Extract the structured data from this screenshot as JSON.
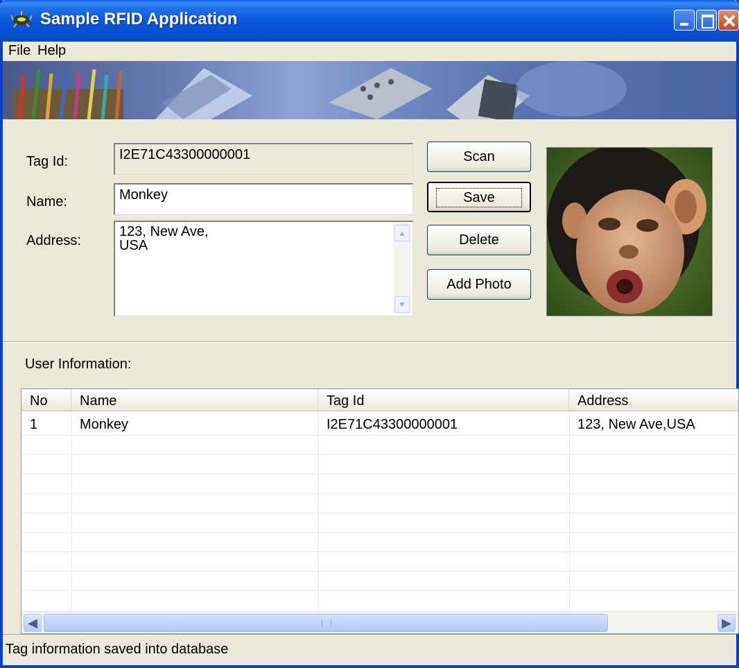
{
  "window": {
    "title": "Sample RFID Application",
    "titlebar_color": "#0a56d8"
  },
  "menu": {
    "items": [
      {
        "label": "File",
        "mnemonic": "F"
      },
      {
        "label": "Help",
        "mnemonic": "H"
      }
    ]
  },
  "form": {
    "tag_id_label": "Tag Id:",
    "tag_id_value": "I2E71C43300000001",
    "name_label": "Name:",
    "name_value": "Monkey",
    "address_label": "Address:",
    "address_line1": "123, New Ave,",
    "address_line2": "USA"
  },
  "buttons": {
    "scan": "Scan",
    "save": "Save",
    "delete": "Delete",
    "add_photo": "Add Photo"
  },
  "user_info": {
    "heading": "User Information:",
    "columns": [
      "No",
      "Name",
      "Tag Id",
      "Address"
    ],
    "rows": [
      {
        "no": "1",
        "name": "Monkey",
        "tag_id": "I2E71C43300000001",
        "address": "123, New Ave,USA"
      }
    ]
  },
  "status": {
    "text": "Tag information saved into database"
  }
}
